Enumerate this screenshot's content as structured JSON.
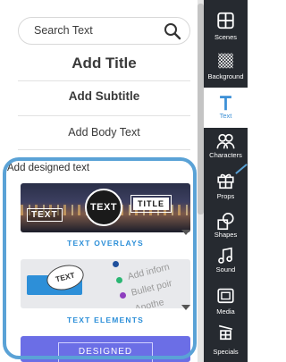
{
  "search": {
    "placeholder": "Search Text"
  },
  "text_buttons": {
    "title": "Add Title",
    "subtitle": "Add Subtitle",
    "body": "Add Body Text"
  },
  "designed": {
    "heading": "Add designed text",
    "overlays": {
      "caption": "TEXT OVERLAYS",
      "tag_text": "TEXT",
      "tag_circle": "TEXT",
      "tag_title": "TITLE"
    },
    "elements": {
      "caption": "TEXT ELEMENTS",
      "bubble": "TEXT",
      "lines": [
        "Add inforn",
        "Bullet poir",
        "Anothe"
      ]
    },
    "third": {
      "label": "DESIGNED"
    }
  },
  "sidebar": {
    "items": [
      {
        "label": "Scenes",
        "icon": "scenes-icon"
      },
      {
        "label": "Background",
        "icon": "background-icon"
      },
      {
        "label": "Text",
        "icon": "text-icon",
        "active": true
      },
      {
        "label": "Characters",
        "icon": "characters-icon"
      },
      {
        "label": "Props",
        "icon": "props-icon"
      },
      {
        "label": "Shapes",
        "icon": "shapes-icon"
      },
      {
        "label": "Sound",
        "icon": "sound-icon"
      },
      {
        "label": "Media",
        "icon": "media-icon"
      },
      {
        "label": "Specials",
        "icon": "specials-icon"
      }
    ]
  },
  "colors": {
    "accent": "#3b8fd6",
    "sidebar_bg": "#262a30",
    "highlight": "#5aa2d6",
    "designed_card": "#6b6ee6"
  }
}
